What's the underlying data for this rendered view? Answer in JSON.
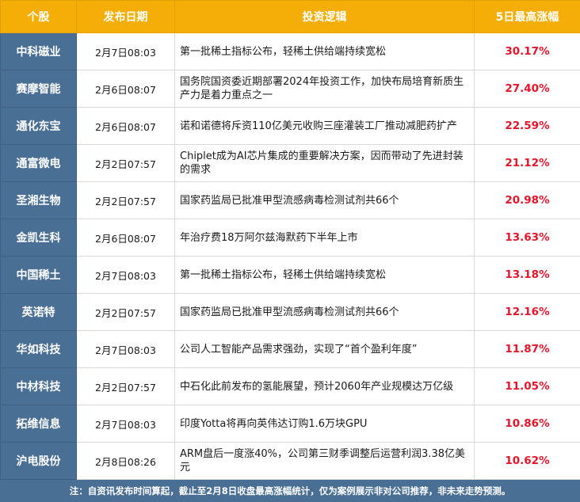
{
  "headers": {
    "stock": "个股",
    "date": "发布日期",
    "logic": "投资逻辑",
    "gain": "5日最高涨幅"
  },
  "rows": [
    {
      "stock": "中科磁业",
      "date": "2月7日08:03",
      "logic": "第一批稀土指标公布，轻稀土供给端持续宽松",
      "gain": "30.17%"
    },
    {
      "stock": "赛摩智能",
      "date": "2月6日08:07",
      "logic": "国务院国资委近期部署2024年投资工作，加快布局培育新质生产力是着力重点之一",
      "gain": "27.40%"
    },
    {
      "stock": "通化东宝",
      "date": "2月6日08:07",
      "logic": "诺和诺德将斥资110亿美元收购三座灌装工厂推动减肥药扩产",
      "gain": "22.59%"
    },
    {
      "stock": "通富微电",
      "date": "2月2日07:57",
      "logic": "Chiplet成为AI芯片集成的重要解决方案，因而带动了先进封装的需求",
      "gain": "21.12%"
    },
    {
      "stock": "圣湘生物",
      "date": "2月2日07:57",
      "logic": "国家药监局已批准甲型流感病毒检测试剂共66个",
      "gain": "20.98%"
    },
    {
      "stock": "金凯生科",
      "date": "2月6日08:07",
      "logic": "年治疗费18万阿尔兹海默药下半年上市",
      "gain": "13.63%"
    },
    {
      "stock": "中国稀土",
      "date": "2月7日08:03",
      "logic": "第一批稀土指标公布，轻稀土供给端持续宽松",
      "gain": "13.18%"
    },
    {
      "stock": "英诺特",
      "date": "2月2日07:57",
      "logic": "国家药监局已批准甲型流感病毒检测试剂共66个",
      "gain": "12.16%"
    },
    {
      "stock": "华如科技",
      "date": "2月7日08:03",
      "logic": "公司人工智能产品需求强劲，实现了“首个盈利年度”",
      "gain": "11.87%"
    },
    {
      "stock": "中材科技",
      "date": "2月2日07:57",
      "logic": "中石化此前发布的氢能展望，预计2060年产业规模达万亿级",
      "gain": "11.05%"
    },
    {
      "stock": "拓维信息",
      "date": "2月7日08:03",
      "logic": "印度Yotta将再向英伟达订购1.6万块GPU",
      "gain": "10.86%"
    },
    {
      "stock": "沪电股份",
      "date": "2月8日08:26",
      "logic": "ARM盘后一度涨40%，公司第三财季调整后运营利润3.38亿美元",
      "gain": "10.62%"
    }
  ],
  "footer": {
    "note": "注：自资讯发布时间算起，截止至2月8日收盘最高涨幅统计，仅为案例展示非对公司推荐，非未来走势预测。"
  },
  "colors": {
    "header_bg": "#f4ae07",
    "name_bg": "#4a6f95",
    "gain_text": "#e8142a"
  }
}
